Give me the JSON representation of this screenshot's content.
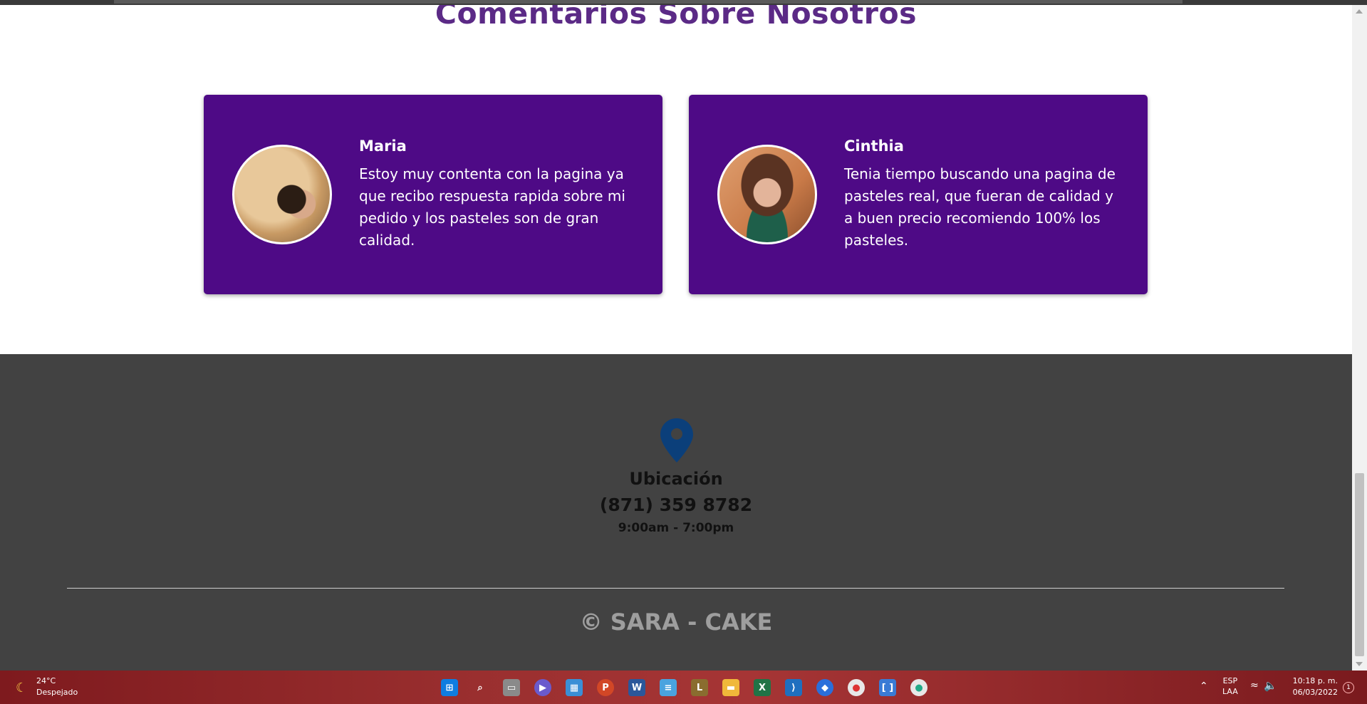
{
  "section": {
    "title": "Comentarios Sobre Nosotros"
  },
  "testimonials": [
    {
      "name": "Maria",
      "comment": "Estoy muy contenta con la pagina ya que recibo respuesta rapida sobre mi pedido y los pasteles son de gran calidad."
    },
    {
      "name": "Cinthia",
      "comment": "Tenia tiempo buscando una pagina de pasteles real, que fueran de calidad y a buen precio recomiendo 100% los pasteles."
    }
  ],
  "footer": {
    "location_label": "Ubicación",
    "phone": "(871) 359 8782",
    "hours": "9:00am - 7:00pm",
    "copyright": "© SARA - CAKE",
    "pin_color": "#0b3f7a"
  },
  "colors": {
    "accent": "#5b2a86",
    "card": "#4e0a86",
    "footer_bg": "#424242"
  },
  "taskbar": {
    "weather_temp": "24°C",
    "weather_desc": "Despejado",
    "lang_1": "ESP",
    "lang_2": "LAA",
    "time": "10:18 p. m.",
    "date": "06/03/2022",
    "notification_count": "1",
    "apps": [
      "start-icon",
      "search-icon",
      "task-view-icon",
      "teams-icon",
      "widgets-icon",
      "powerpoint-icon",
      "word-icon",
      "notepad-icon",
      "game-icon",
      "file-explorer-icon",
      "excel-icon",
      "vscode-icon",
      "app-icon",
      "chrome-icon",
      "terminal-icon",
      "chrome-active-icon"
    ]
  }
}
